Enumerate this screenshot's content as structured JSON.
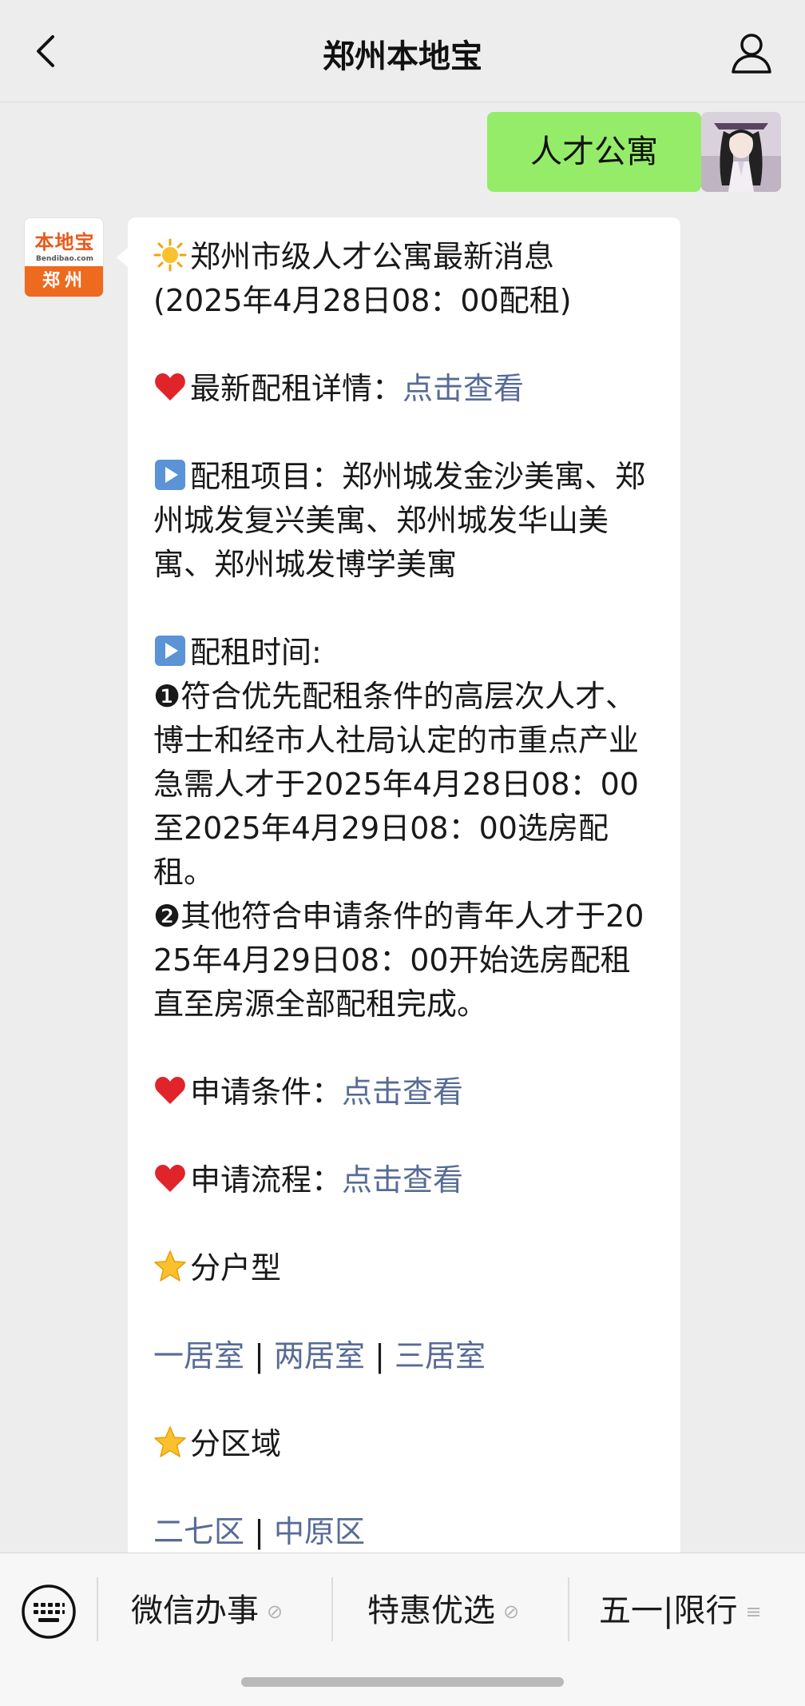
{
  "header": {
    "title": "郑州本地宝",
    "back_icon": "chevron-left-icon",
    "profile_icon": "person-icon"
  },
  "my_message": {
    "text": "人才公寓"
  },
  "bot": {
    "logo_cn": "本地宝",
    "logo_en": "Bendibao.com",
    "logo_city": "郑州"
  },
  "reply": {
    "title_line1": "郑州市级人才公寓最新消息",
    "title_line2": "(2025年4月28日08：00配租)",
    "latest_label": "最新配租详情：",
    "latest_link": "点击查看",
    "projects_label": "配租项目：",
    "projects_text": "郑州城发金沙美寓、郑州城发复兴美寓、郑州城发华山美寓、郑州城发博学美寓",
    "time_label": "配租时间:",
    "time_item1_num": "❶",
    "time_item1": "符合优先配租条件的高层次人才、博士和经市人社局认定的市重点产业急需人才于2025年4月28日08：00至2025年4月29日08：00选房配租。",
    "time_item2_num": "❷",
    "time_item2": "其他符合申请条件的青年人才于2025年4月29日08：00开始选房配租直至房源全部配租完成。",
    "conditions_label": "申请条件：",
    "conditions_link": "点击查看",
    "process_label": "申请流程：",
    "process_link": "点击查看",
    "by_type_label": "分户型",
    "type_links": [
      "一居室",
      "两居室",
      "三居室"
    ],
    "separator": "|",
    "by_area_label": "分区域",
    "area_links": [
      "二七区",
      "中原区"
    ]
  },
  "menu": {
    "items": [
      "微信办事",
      "特惠优选",
      "五一|限行"
    ],
    "keyboard_icon": "keyboard-icon",
    "link_mark": "⊘",
    "list_mark": "≡"
  },
  "colors": {
    "my_bubble": "#95ec69",
    "link": "#576b95",
    "background": "#ededed",
    "logo_orange": "#ee6a1f"
  }
}
